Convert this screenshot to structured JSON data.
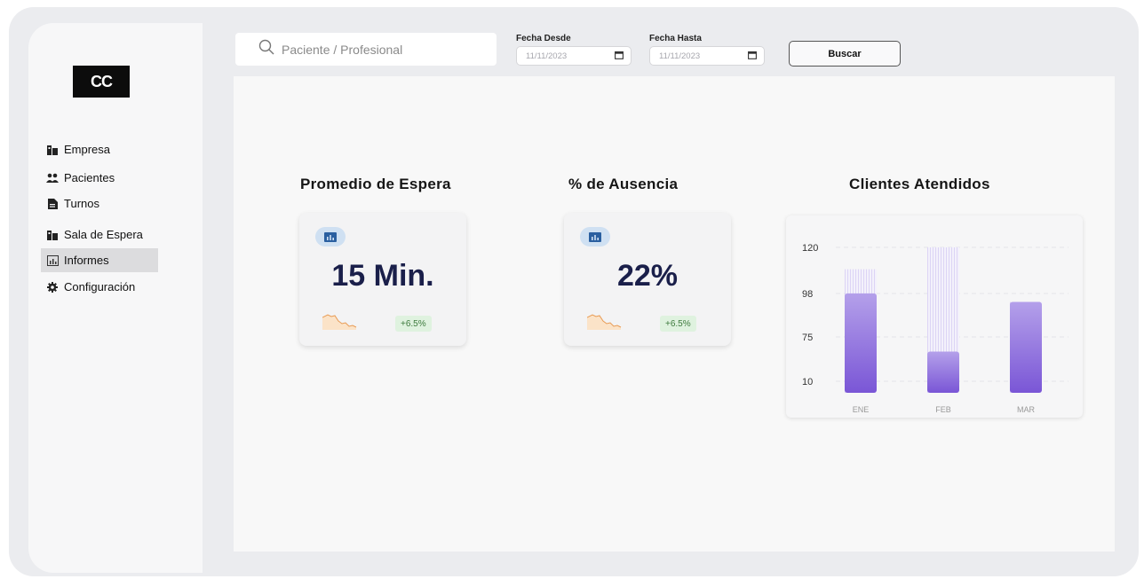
{
  "sidebar": {
    "logo": "CC",
    "items": [
      {
        "label": "Empresa",
        "icon": "building-icon"
      },
      {
        "label": "Pacientes",
        "icon": "users-icon"
      },
      {
        "label": "Turnos",
        "icon": "file-icon"
      },
      {
        "label": "Sala de Espera",
        "icon": "building-icon"
      },
      {
        "label": "Informes",
        "icon": "chart-icon",
        "active": true
      },
      {
        "label": "Configuración",
        "icon": "gear-icon"
      }
    ]
  },
  "search": {
    "placeholder": "Paciente / Profesional"
  },
  "filters": {
    "from_label": "Fecha Desde",
    "from_value": "11/11/2023",
    "to_label": "Fecha Hasta",
    "to_value": "11/11/2023",
    "button": "Buscar"
  },
  "kpis": [
    {
      "title": "Promedio de Espera",
      "value": "15 Min.",
      "change": "+6.5%"
    },
    {
      "title": "% de Ausencia",
      "value": "22%",
      "change": "+6.5%"
    }
  ],
  "chart_data": {
    "type": "bar",
    "title": "Clientes Atendidos",
    "categories": [
      "ENE",
      "FEB",
      "MAR"
    ],
    "y_tick_labels": [
      "120",
      "98",
      "75",
      "10"
    ],
    "series": [
      {
        "values": [
          102,
          120,
          75
        ]
      },
      {
        "values": [
          82,
          34,
          75
        ]
      }
    ]
  },
  "colors": {
    "accent": "#7b58d6",
    "bar_light": "#b19be9",
    "kpi_value": "#1a1f4a",
    "pill_bg": "#dff2df",
    "pill_text": "#3d7a3d"
  }
}
